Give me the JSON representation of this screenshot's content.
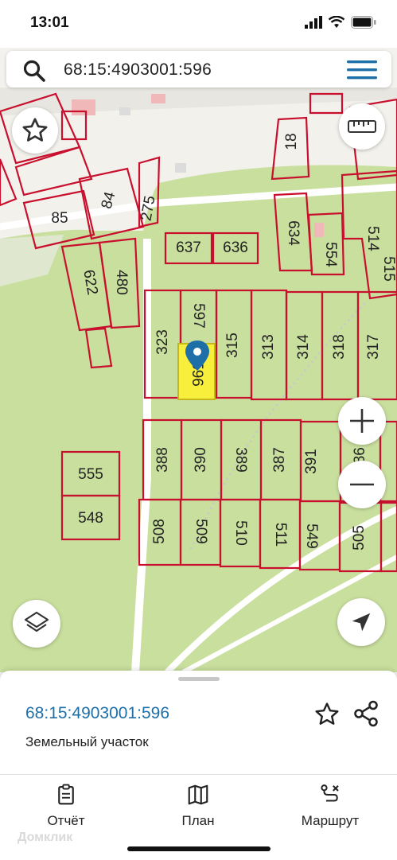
{
  "status_bar": {
    "time": "13:01"
  },
  "search": {
    "query": "68:15:4903001:596"
  },
  "map": {
    "parcel_labels": [
      "18",
      "85",
      "84",
      "275",
      "637",
      "636",
      "634",
      "554",
      "514",
      "515",
      "622",
      "480",
      "323",
      "597",
      "596",
      "315",
      "313",
      "314",
      "318",
      "317",
      "388",
      "390",
      "389",
      "387",
      "391",
      "386",
      "555",
      "548",
      "508",
      "509",
      "510",
      "511",
      "549",
      "505"
    ],
    "selected_parcel_label": "596"
  },
  "info_sheet": {
    "parcel_id": "68:15:4903001:596",
    "parcel_type": "Земельный участок"
  },
  "bottom_nav": [
    {
      "label": "Отчёт",
      "icon": "report-icon"
    },
    {
      "label": "План",
      "icon": "map-plan-icon"
    },
    {
      "label": "Маршрут",
      "icon": "route-icon"
    }
  ],
  "watermark": "Домклик",
  "colors": {
    "accent": "#1e6fa8",
    "parcel_border": "#c8102e",
    "selected_fill": "#f7ef3c",
    "park": "#c9df9e"
  }
}
